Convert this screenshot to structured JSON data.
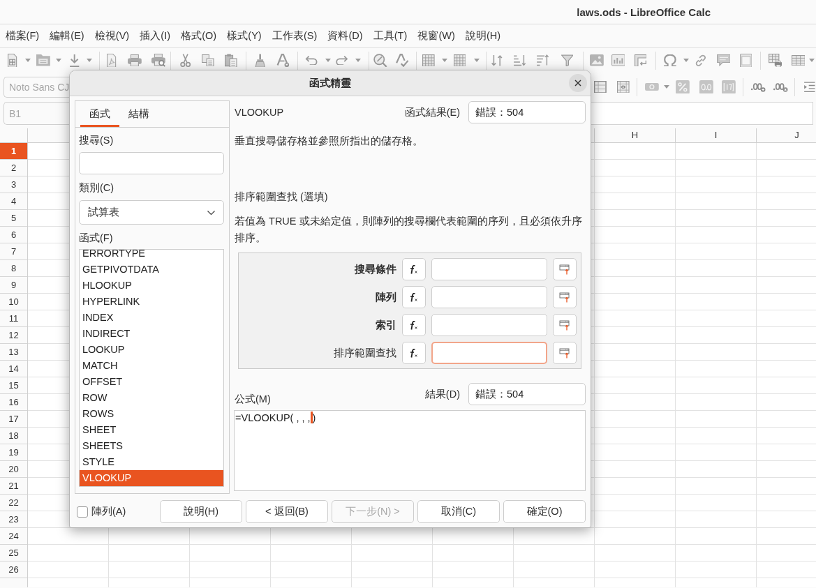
{
  "window": {
    "title": "laws.ods - LibreOffice Calc"
  },
  "menu": [
    "檔案(F)",
    "編輯(E)",
    "檢視(V)",
    "插入(I)",
    "格式(O)",
    "樣式(Y)",
    "工作表(S)",
    "資料(D)",
    "工具(T)",
    "視窗(W)",
    "說明(H)"
  ],
  "formatting_bar": {
    "font_name": "Noto Sans CJ"
  },
  "formula_bar": {
    "name_box": "B1"
  },
  "sheet": {
    "columns": [
      "H",
      "I",
      "J"
    ],
    "rows": [
      {
        "label": "1",
        "selected": true
      },
      {
        "label": "2",
        "selected": false
      },
      {
        "label": "3",
        "selected": false
      },
      {
        "label": "4",
        "selected": false
      },
      {
        "label": "5",
        "selected": false
      },
      {
        "label": "6",
        "selected": false
      },
      {
        "label": "7",
        "selected": false
      },
      {
        "label": "8",
        "selected": false
      },
      {
        "label": "9",
        "selected": false
      },
      {
        "label": "10",
        "selected": false
      },
      {
        "label": "11",
        "selected": false
      },
      {
        "label": "12",
        "selected": false
      },
      {
        "label": "13",
        "selected": false
      },
      {
        "label": "14",
        "selected": false
      },
      {
        "label": "15",
        "selected": false
      },
      {
        "label": "16",
        "selected": false
      },
      {
        "label": "17",
        "selected": false
      },
      {
        "label": "18",
        "selected": false
      },
      {
        "label": "19",
        "selected": false
      },
      {
        "label": "20",
        "selected": false
      },
      {
        "label": "21",
        "selected": false
      },
      {
        "label": "22",
        "selected": false
      },
      {
        "label": "23",
        "selected": false
      },
      {
        "label": "24",
        "selected": false
      },
      {
        "label": "25",
        "selected": false
      },
      {
        "label": "26",
        "selected": false
      }
    ]
  },
  "dialog": {
    "title": "函式精靈",
    "tabs": [
      {
        "label": "函式",
        "selected": true
      },
      {
        "label": "結構",
        "selected": false
      }
    ],
    "search": {
      "label": "搜尋(S)"
    },
    "category": {
      "label": "類別(C)",
      "value": "試算表"
    },
    "functions": {
      "label": "函式(F)",
      "items": [
        {
          "name": "ERRORTYPE",
          "selected": false
        },
        {
          "name": "GETPIVOTDATA",
          "selected": false
        },
        {
          "name": "HLOOKUP",
          "selected": false
        },
        {
          "name": "HYPERLINK",
          "selected": false
        },
        {
          "name": "INDEX",
          "selected": false
        },
        {
          "name": "INDIRECT",
          "selected": false
        },
        {
          "name": "LOOKUP",
          "selected": false
        },
        {
          "name": "MATCH",
          "selected": false
        },
        {
          "name": "OFFSET",
          "selected": false
        },
        {
          "name": "ROW",
          "selected": false
        },
        {
          "name": "ROWS",
          "selected": false
        },
        {
          "name": "SHEET",
          "selected": false
        },
        {
          "name": "SHEETS",
          "selected": false
        },
        {
          "name": "STYLE",
          "selected": false
        },
        {
          "name": "VLOOKUP",
          "selected": true
        }
      ]
    },
    "function_name": "VLOOKUP",
    "function_result": {
      "label": "函式結果(E)",
      "value": "錯誤：504"
    },
    "description": "垂直搜尋儲存格並參照所指出的儲存格。",
    "argument_title": "排序範圍查找 (選填)",
    "argument_description": "若值為 TRUE 或未給定值，則陣列的搜尋欄代表範圍的序列，且必須依升序排序。",
    "arguments": [
      {
        "label": "搜尋條件",
        "required": true,
        "focused": false
      },
      {
        "label": "陣列",
        "required": true,
        "focused": false
      },
      {
        "label": "索引",
        "required": true,
        "focused": false
      },
      {
        "label": "排序範圍查找",
        "required": false,
        "focused": true
      }
    ],
    "formula": {
      "label": "公式(M)",
      "text_before_cursor": "=VLOOKUP( , , ,",
      "text_after_cursor": ")"
    },
    "result": {
      "label": "結果(D)",
      "value": "錯誤：504"
    },
    "array_checkbox": {
      "label": "陣列(A)",
      "checked": false
    },
    "buttons": [
      {
        "label": "說明(H)",
        "disabled": false
      },
      {
        "label": "< 返回(B)",
        "disabled": false
      },
      {
        "label": "下一步(N) >",
        "disabled": true
      },
      {
        "label": "取消(C)",
        "disabled": false
      },
      {
        "label": "確定(O)",
        "disabled": false
      }
    ]
  }
}
